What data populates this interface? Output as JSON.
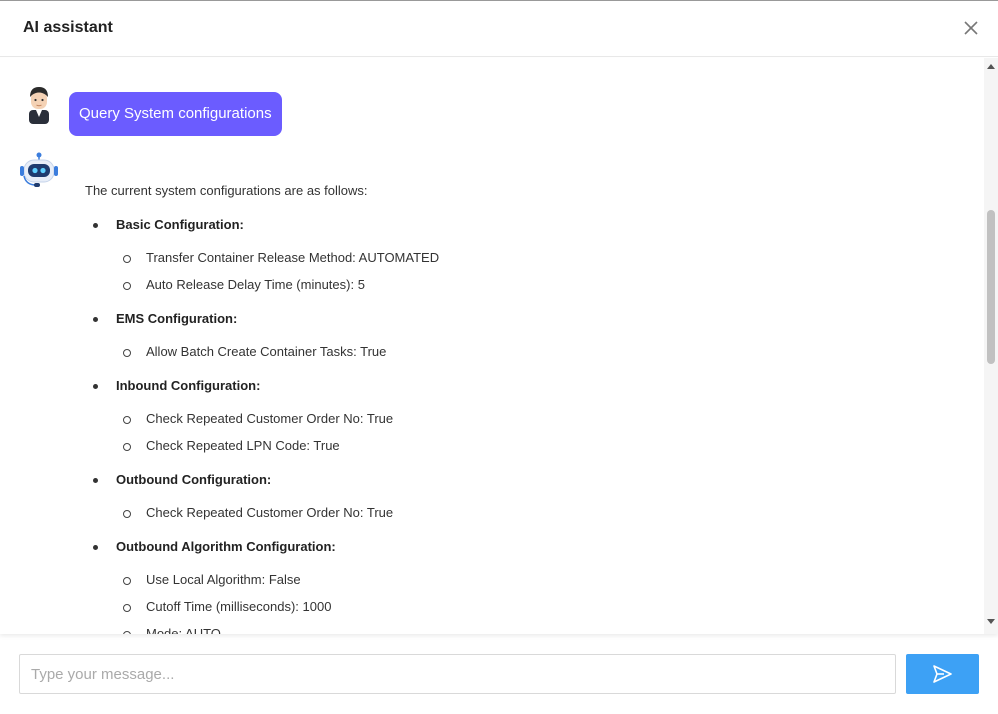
{
  "header": {
    "title": "AI assistant",
    "close_icon": "close-icon"
  },
  "chat": {
    "user_message": "Query System configurations",
    "bot_intro": "The current system configurations are as follows:",
    "sections": [
      {
        "title": "Basic Configuration:",
        "items": [
          "Transfer Container Release Method: AUTOMATED",
          "Auto Release Delay Time (minutes): 5"
        ]
      },
      {
        "title": "EMS Configuration:",
        "items": [
          "Allow Batch Create Container Tasks: True"
        ]
      },
      {
        "title": "Inbound Configuration:",
        "items": [
          "Check Repeated Customer Order No: True",
          "Check Repeated LPN Code: True"
        ]
      },
      {
        "title": "Outbound Configuration:",
        "items": [
          "Check Repeated Customer Order No: True"
        ]
      },
      {
        "title": "Outbound Algorithm Configuration:",
        "items": [
          "Use Local Algorithm: False",
          "Cutoff Time (milliseconds): 1000",
          "Mode: AUTO"
        ]
      }
    ]
  },
  "composer": {
    "placeholder": "Type your message...",
    "send_icon": "send-icon"
  },
  "colors": {
    "user_bubble": "#6b5cff",
    "send_button": "#3da1f5"
  }
}
